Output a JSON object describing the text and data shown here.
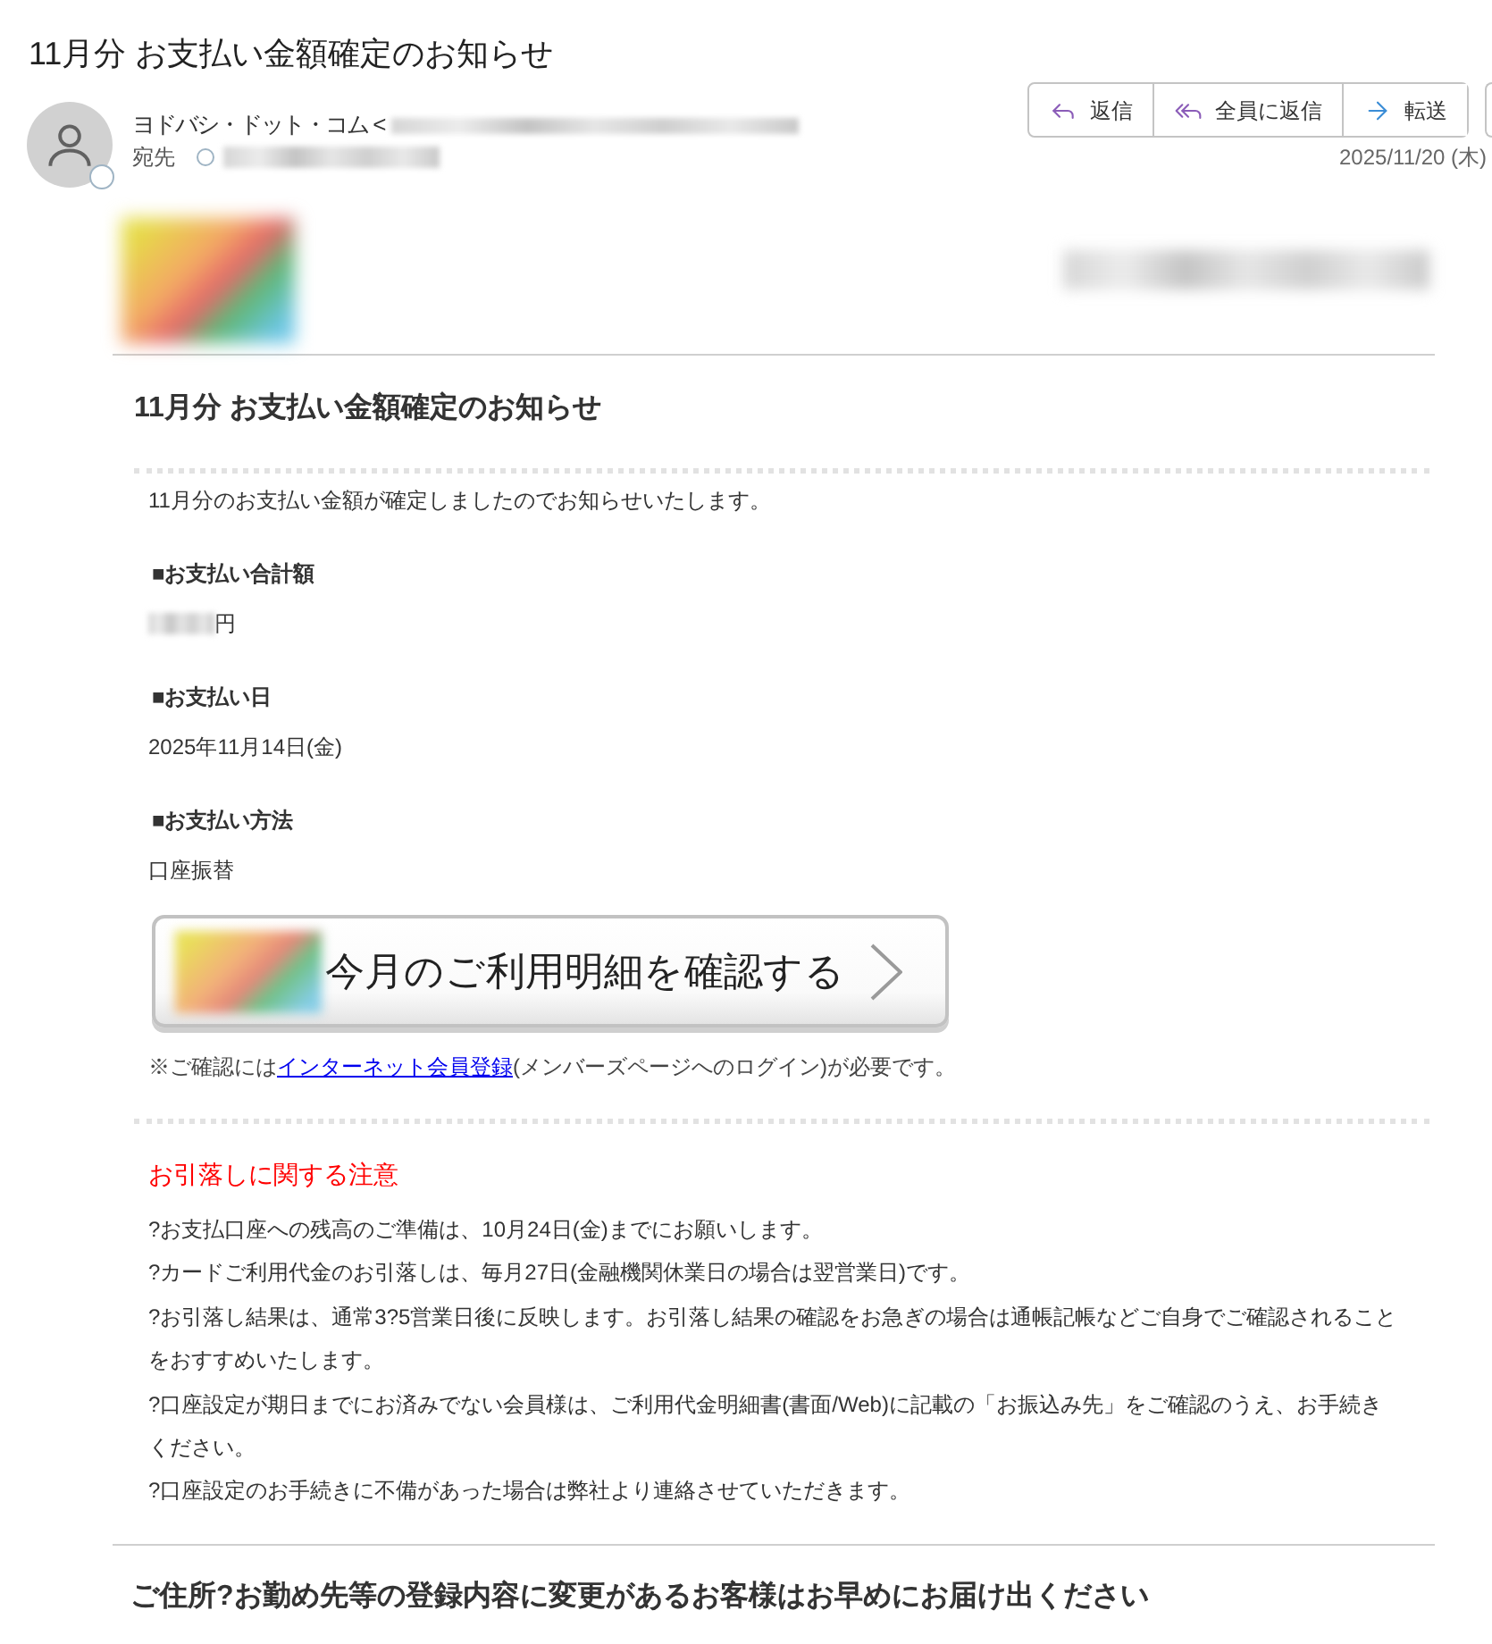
{
  "message": {
    "subject": "11月分 お支払い金額確定のお知らせ",
    "sender": {
      "name": "ヨドバシ・ドット・コム <",
      "address_redacted": true
    },
    "recipient": {
      "label": "宛先",
      "address_redacted": true
    },
    "actions": [
      {
        "kind": "reply",
        "label": "返信"
      },
      {
        "kind": "reply_all",
        "label": "全員に返信"
      },
      {
        "kind": "forward",
        "label": "転送"
      }
    ],
    "date": "2025/11/20 (木)"
  },
  "email": {
    "header_text_redacted": true,
    "title": "11月分 お支払い金額確定のお知らせ",
    "intro": "11月分のお支払い金額が確定しましたのでお知らせいたします。",
    "sections": [
      {
        "heading": "■お支払い合計額",
        "value": "円",
        "value_redacted": true
      },
      {
        "heading": "■お支払い日",
        "value": "2025年11月14日(金)",
        "value_redacted": false
      },
      {
        "heading": "■お支払い方法",
        "value": "口座振替",
        "value_redacted": false
      }
    ],
    "statement_button": {
      "label": "今月のご利用明細を確認する"
    },
    "note": {
      "before_link": "※ご確認には",
      "link": "インターネット会員登録",
      "after_link": "(メンバーズページへのログイン)が必要です。"
    },
    "notice": {
      "title": "お引落しに関する注意",
      "items": [
        "?お支払口座への残高のご準備は、10月24日(金)までにお願いします。",
        "?カードご利用代金のお引落しは、毎月27日(金融機関休業日の場合は翌営業日)です。",
        "?お引落し結果は、通常3?5営業日後に反映します。お引落し結果の確認をお急ぎの場合は通帳記帳などご自身でご確認されることをおすすめいたします。",
        "?口座設定が期日までにお済みでない会員様は、ご利用代金明細書(書面/Web)に記載の「お振込み先」をご確認のうえ、お手続きください。",
        "?口座設定のお手続きに不備があった場合は弊社より連絡させていただきます。"
      ]
    },
    "footer_heading": "ご住所?お勤め先等の登録内容に変更があるお客様はお早めにお届け出ください"
  }
}
